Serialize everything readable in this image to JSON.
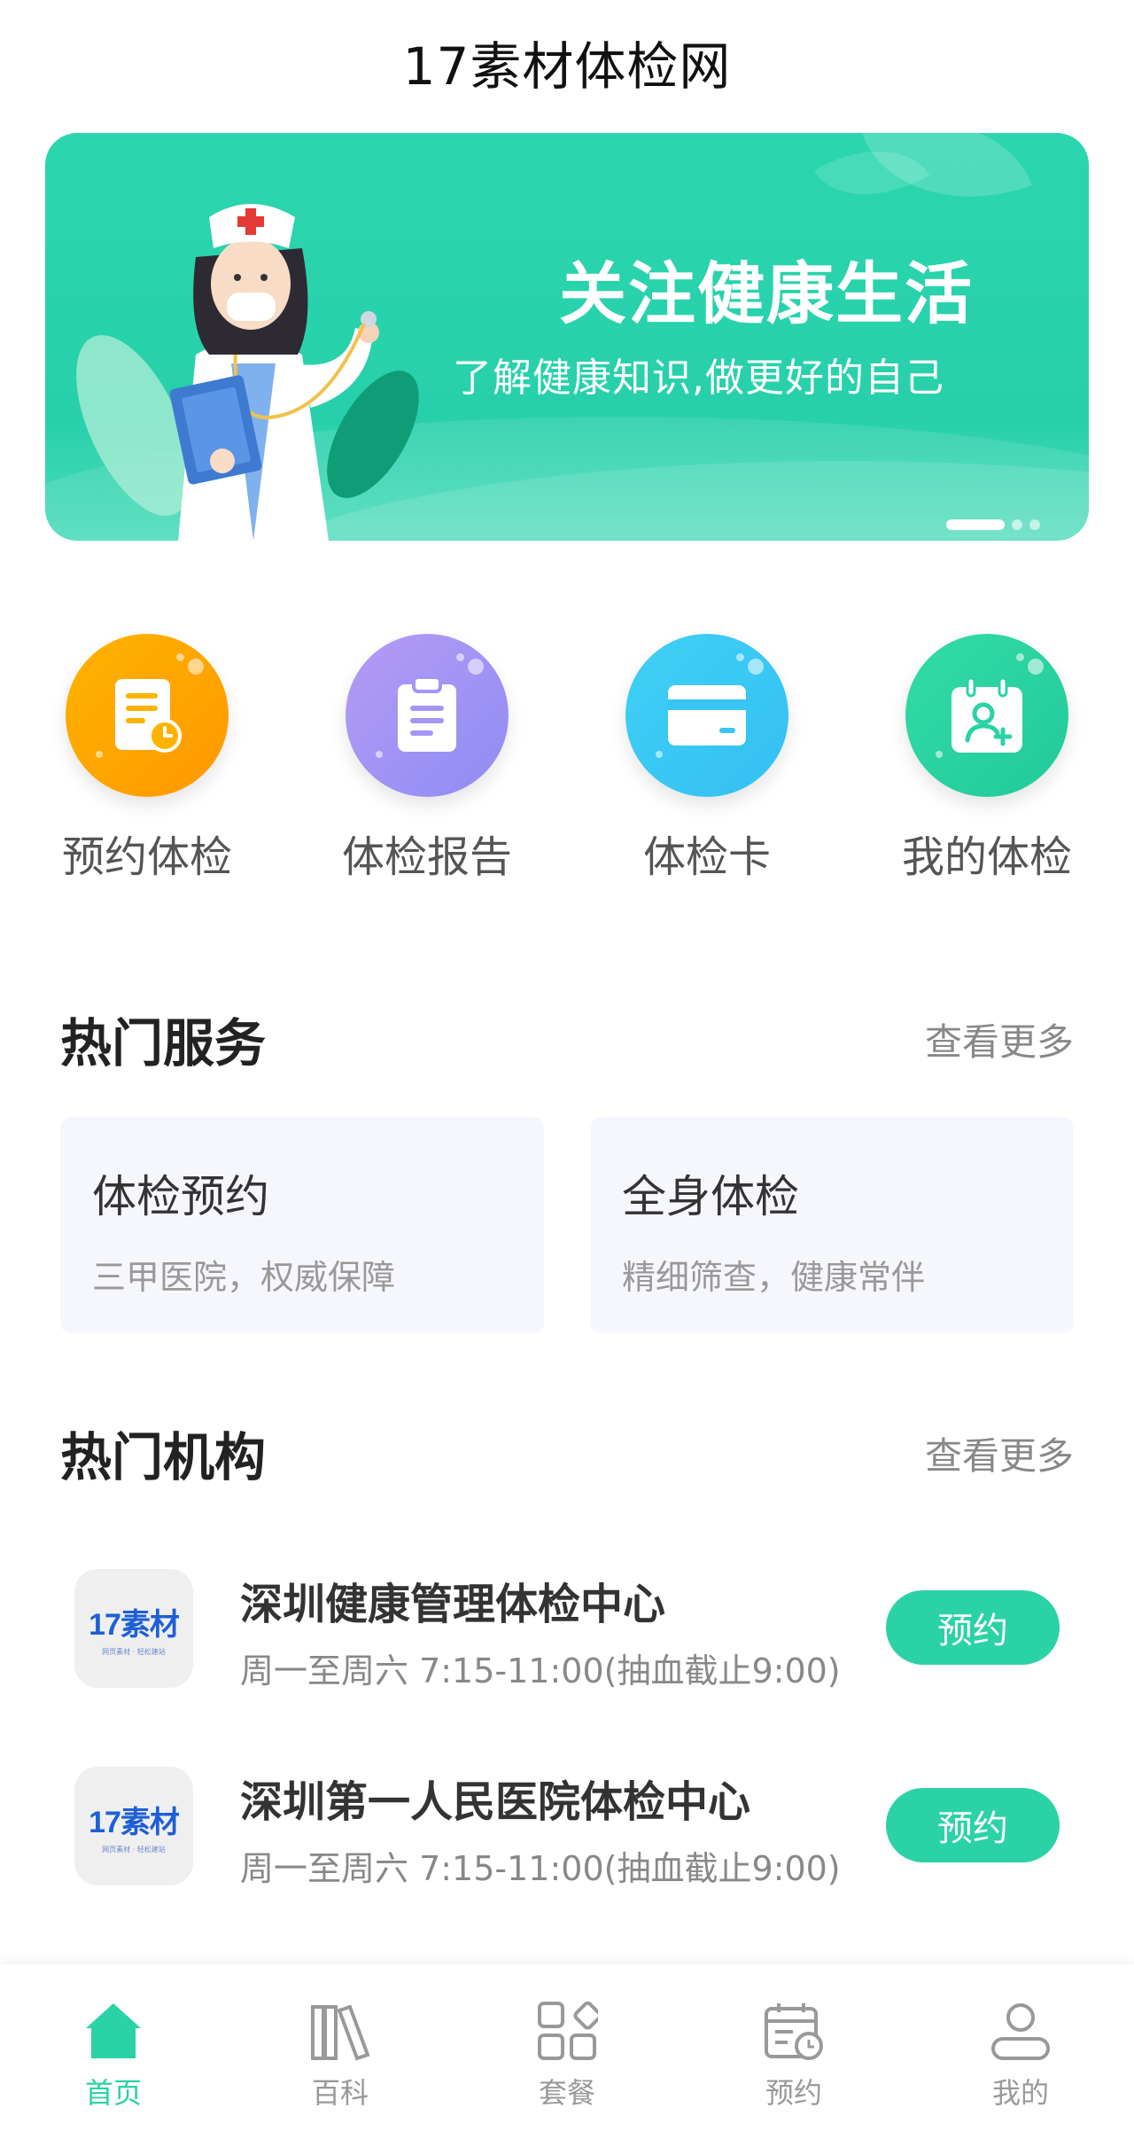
{
  "header": {
    "title": "17素材体检网"
  },
  "banner": {
    "title": "关注健康生活",
    "subtitle": "了解健康知识,做更好的自己"
  },
  "quick_actions": [
    {
      "label": "预约体检",
      "icon": "appointment-document-icon",
      "color_from": "#ffb300",
      "color_to": "#ff9800"
    },
    {
      "label": "体检报告",
      "icon": "clipboard-report-icon",
      "color_from": "#b59bf5",
      "color_to": "#8f8cf3"
    },
    {
      "label": "体检卡",
      "icon": "card-icon",
      "color_from": "#3fd0f5",
      "color_to": "#34bff2"
    },
    {
      "label": "我的体检",
      "icon": "calendar-user-icon",
      "color_from": "#33dca6",
      "color_to": "#22c99a"
    }
  ],
  "hot_services": {
    "title": "热门服务",
    "more": "查看更多",
    "items": [
      {
        "title": "体检预约",
        "subtitle": "三甲医院，权威保障"
      },
      {
        "title": "全身体检",
        "subtitle": "精细筛查，健康常伴"
      }
    ]
  },
  "hot_orgs": {
    "title": "热门机构",
    "more": "查看更多",
    "items": [
      {
        "logo_text": "17素材",
        "logo_tag": "网页素材 · 轻松建站",
        "name": "深圳健康管理体检中心",
        "hours": "周一至周六 7:15-11:00(抽血截止9:00)",
        "button": "预约"
      },
      {
        "logo_text": "17素材",
        "logo_tag": "网页素材 · 轻松建站",
        "name": "深圳第一人民医院体检中心",
        "hours": "周一至周六 7:15-11:00(抽血截止9:00)",
        "button": "预约"
      }
    ]
  },
  "tabbar": [
    {
      "label": "首页",
      "icon": "home-icon",
      "active": true
    },
    {
      "label": "百科",
      "icon": "books-icon",
      "active": false
    },
    {
      "label": "套餐",
      "icon": "grid-icon",
      "active": false
    },
    {
      "label": "预约",
      "icon": "calendar-clock-icon",
      "active": false
    },
    {
      "label": "我的",
      "icon": "user-icon",
      "active": false
    }
  ],
  "colors": {
    "accent": "#2bd2a6",
    "banner": "#2bd6ae",
    "text": "#333333",
    "muted": "#888888"
  }
}
